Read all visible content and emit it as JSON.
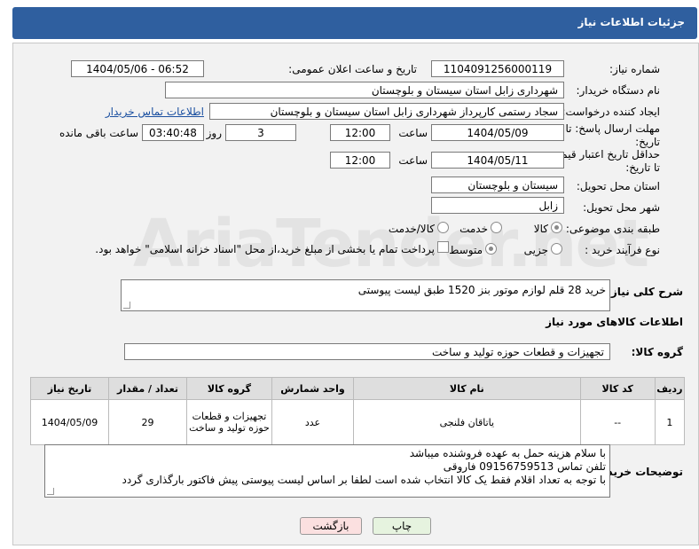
{
  "header": {
    "title": "جزئیات اطلاعات نیاز"
  },
  "form": {
    "need_number_label": "شماره نیاز:",
    "need_number": "1104091256000119",
    "announce_label": "تاریخ و ساعت اعلان عمومی:",
    "announce_value": "1404/05/06 - 06:52",
    "buyer_org_label": "نام دستگاه خریدار:",
    "buyer_org": "شهرداری زابل استان سیستان و بلوچستان",
    "creator_label": "ایجاد کننده درخواست:",
    "creator": "سجاد رستمی کارپرداز شهرداری زابل استان سیستان و بلوچستان",
    "contact_link": "اطلاعات تماس خریدار",
    "deadline_label_1": "مهلت ارسال پاسخ: تا",
    "deadline_label_2": "تاریخ:",
    "deadline_date": "1404/05/09",
    "time_word": "ساعت",
    "deadline_time": "12:00",
    "days_value": "3",
    "days_word": "روز و",
    "remaining_time": "03:40:48",
    "remaining_word": "ساعت باقی مانده",
    "validity_label_1": "حداقل تاریخ اعتبار قیمت:",
    "validity_label_2": "تا تاریخ:",
    "validity_date": "1404/05/11",
    "validity_time": "12:00",
    "province_label": "استان محل تحویل:",
    "province": "سیستان و بلوچستان",
    "city_label": "شهر محل تحویل:",
    "city": "زابل",
    "category_label": "طبقه بندی موضوعی:",
    "category_options": [
      "کالا",
      "خدمت",
      "کالا/خدمت"
    ],
    "purchase_type_label": "نوع فرآیند خرید :",
    "purchase_options": [
      "جزیی",
      "متوسط"
    ],
    "payment_note": "پرداخت تمام یا بخشی از مبلغ خرید،از محل \"اسناد خزانه اسلامی\" خواهد بود.",
    "summary_label": "شرح کلی نیاز:",
    "summary": "خرید 28 قلم لوازم موتور بنز 1520 طبق لیست پیوستی",
    "goods_info_title": "اطلاعات کالاهای مورد نیاز",
    "goods_group_label": "گروه کالا:",
    "goods_group": "تجهیزات و قطعات حوزه تولید و ساخت"
  },
  "table": {
    "headers": [
      "ردیف",
      "کد کالا",
      "نام کالا",
      "واحد شمارش",
      "گروه کالا",
      "تعداد / مقدار",
      "تاریخ نیاز"
    ],
    "rows": [
      {
        "row": "1",
        "code": "--",
        "name": "یاتاقان فلنجی",
        "unit": "عدد",
        "group": "تجهیزات و قطعات حوزه تولید و ساخت",
        "qty": "29",
        "date": "1404/05/09"
      }
    ]
  },
  "notes": {
    "label": "توضیحات خریدار:",
    "line1": "با سلام هزینه حمل به عهده فروشنده میباشد",
    "line2": "تلفن تماس 09156759513 فاروقی",
    "line3": "با توجه به تعداد اقلام فقط یک کالا انتخاب شده است لطفا بر اساس لیست پیوستی پیش فاکتور بارگذاری گردد"
  },
  "buttons": {
    "print": "چاپ",
    "back": "بازگشت"
  },
  "watermark": "AriaTender.net",
  "colors": {
    "header": "#2f5f9f",
    "link": "#1a4fa0",
    "print_btn": "#e6f3df",
    "back_btn": "#fbe0e0"
  }
}
